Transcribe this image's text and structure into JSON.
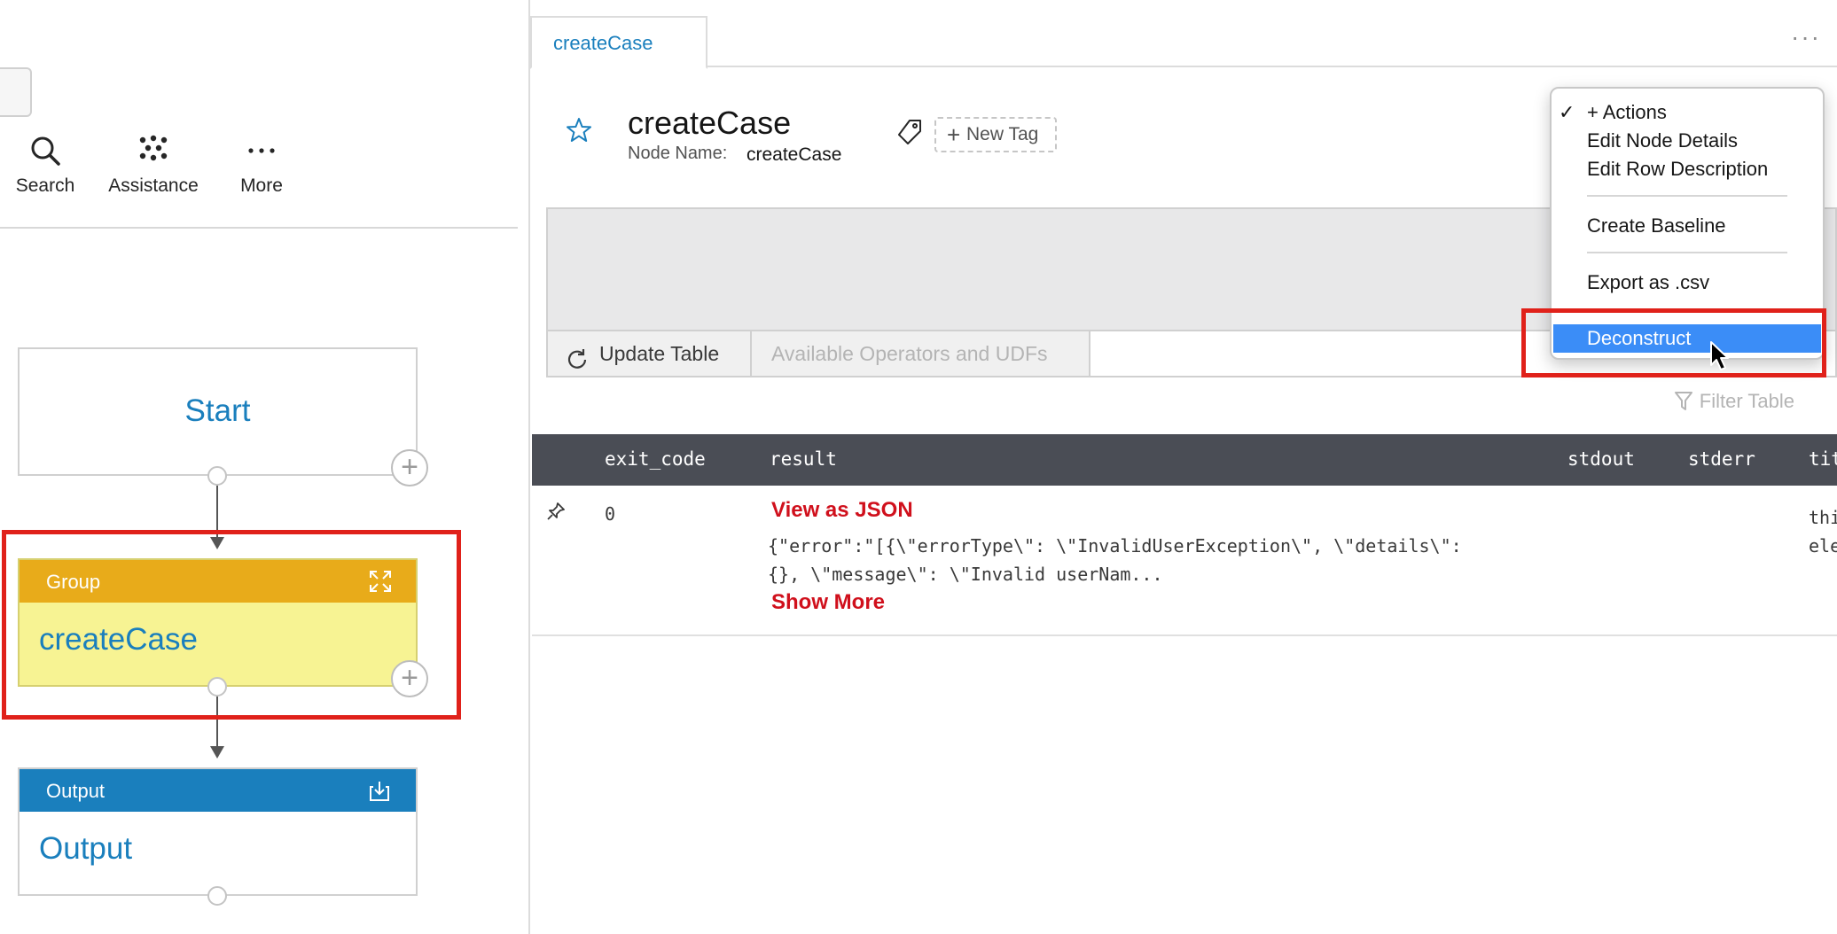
{
  "left": {
    "toolbar": {
      "search_label": "Search",
      "assistance_label": "Assistance",
      "more_label": "More"
    },
    "flow": {
      "start_label": "Start",
      "group_header": "Group",
      "group_title": "createCase",
      "output_header": "Output",
      "output_title": "Output"
    }
  },
  "right": {
    "tab_label": "createCase",
    "header": {
      "title": "createCase",
      "node_name_label": "Node Name:",
      "node_name_value": "createCase",
      "new_tag_label": "New Tag"
    },
    "editor": {
      "update_table_label": "Update Table",
      "operators_label": "Available Operators and UDFs"
    },
    "filter_label": "Filter Table",
    "table": {
      "columns": [
        "exit_code",
        "result",
        "stdout",
        "stderr",
        "title"
      ],
      "row": {
        "exit_code": "0",
        "view_json_label": "View as JSON",
        "result_line1": "{\"error\":\"[{\\\"errorType\\\": \\\"InvalidUserException\\\", \\\"details\\\":",
        "result_line2": "{}, \\\"message\\\": \\\"Invalid userNam...",
        "show_more_label": "Show More",
        "title_line1": "this",
        "title_line2": "elem"
      }
    },
    "menu": {
      "items": [
        "+ Actions",
        "Edit Node Details",
        "Edit Row Description",
        "Create Baseline",
        "Export as .csv",
        "Deconstruct"
      ],
      "selected": "Deconstruct"
    }
  },
  "colors": {
    "accent": "#1a7fbd",
    "group_header": "#e8ab1a",
    "group_body": "#f7f393",
    "highlight": "#e0211a",
    "menu_selected": "#3b8df7",
    "link_red": "#d0101c",
    "table_header": "#4a4d55"
  }
}
